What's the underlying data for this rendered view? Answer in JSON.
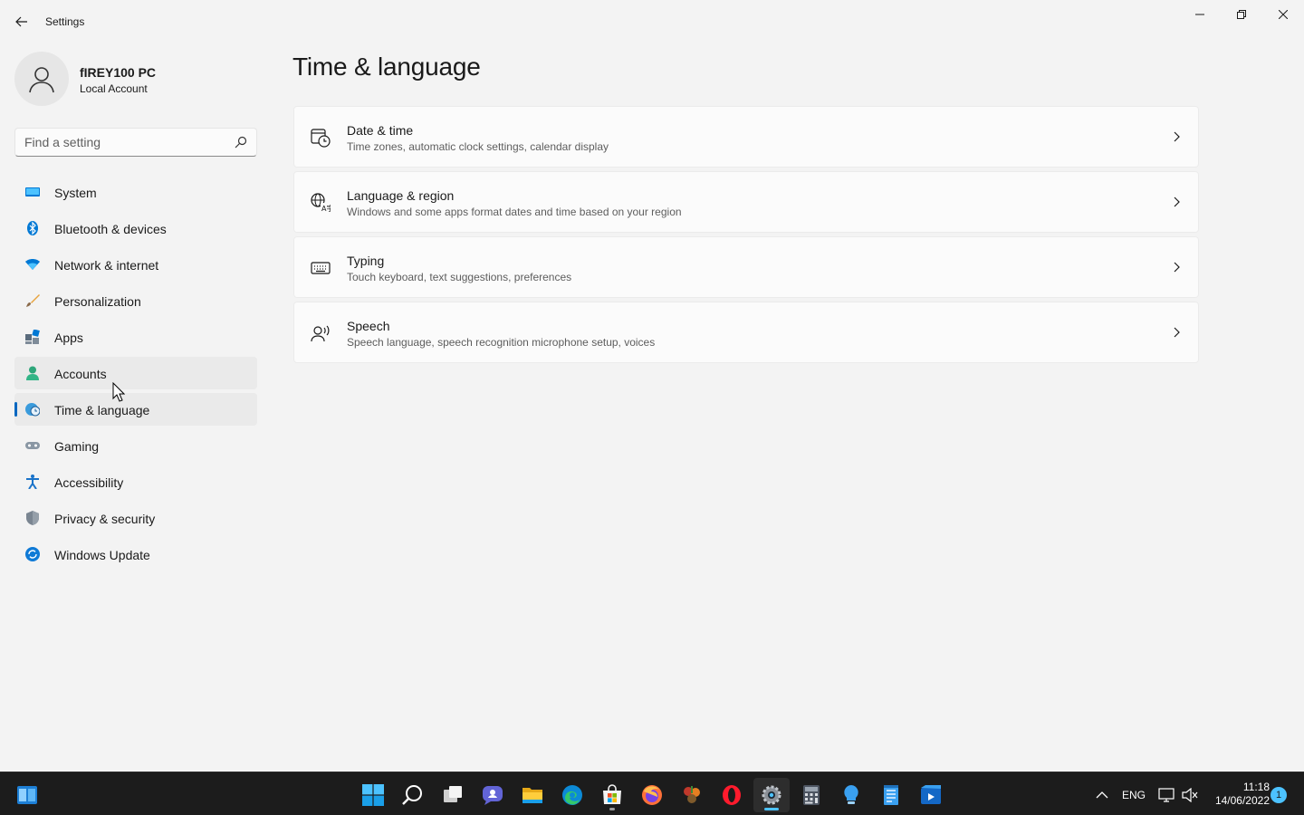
{
  "window": {
    "title": "Settings",
    "controls": {
      "minimize": "minimize-icon",
      "maximize": "restore-icon",
      "close": "close-icon"
    }
  },
  "profile": {
    "name": "fIREY100 PC",
    "account_type": "Local Account"
  },
  "search": {
    "placeholder": "Find a setting",
    "value": ""
  },
  "sidebar": {
    "items": [
      {
        "label": "System",
        "icon": "system-icon",
        "state": ""
      },
      {
        "label": "Bluetooth & devices",
        "icon": "bluetooth-icon",
        "state": ""
      },
      {
        "label": "Network & internet",
        "icon": "wifi-icon",
        "state": ""
      },
      {
        "label": "Personalization",
        "icon": "brush-icon",
        "state": ""
      },
      {
        "label": "Apps",
        "icon": "apps-icon",
        "state": ""
      },
      {
        "label": "Accounts",
        "icon": "person-icon",
        "state": "hover"
      },
      {
        "label": "Time & language",
        "icon": "globe-clock-icon",
        "state": "selected"
      },
      {
        "label": "Gaming",
        "icon": "gamepad-icon",
        "state": ""
      },
      {
        "label": "Accessibility",
        "icon": "accessibility-icon",
        "state": ""
      },
      {
        "label": "Privacy & security",
        "icon": "shield-icon",
        "state": ""
      },
      {
        "label": "Windows Update",
        "icon": "update-icon",
        "state": ""
      }
    ]
  },
  "main": {
    "title": "Time & language",
    "cards": [
      {
        "title": "Date & time",
        "subtitle": "Time zones, automatic clock settings, calendar display",
        "icon": "calendar-clock-icon"
      },
      {
        "title": "Language & region",
        "subtitle": "Windows and some apps format dates and time based on your region",
        "icon": "language-icon"
      },
      {
        "title": "Typing",
        "subtitle": "Touch keyboard, text suggestions, preferences",
        "icon": "keyboard-icon"
      },
      {
        "title": "Speech",
        "subtitle": "Speech language, speech recognition microphone setup, voices",
        "icon": "speech-icon"
      }
    ]
  },
  "taskbar": {
    "apps": [
      "start-icon",
      "search-icon",
      "task-view-icon",
      "chat-icon",
      "file-explorer-icon",
      "edge-icon",
      "store-icon",
      "firefox-icon",
      "app-icon",
      "opera-icon",
      "settings-icon",
      "calculator-icon",
      "tips-icon",
      "notepad-icon",
      "movies-icon"
    ],
    "tray": {
      "language": "ENG",
      "time": "11:18",
      "date": "14/06/2022",
      "notification_count": "1"
    }
  },
  "colors": {
    "accent": "#0067c0",
    "background": "#f3f3f3",
    "card": "#fbfbfb",
    "taskbar": "#1c1c1c"
  }
}
